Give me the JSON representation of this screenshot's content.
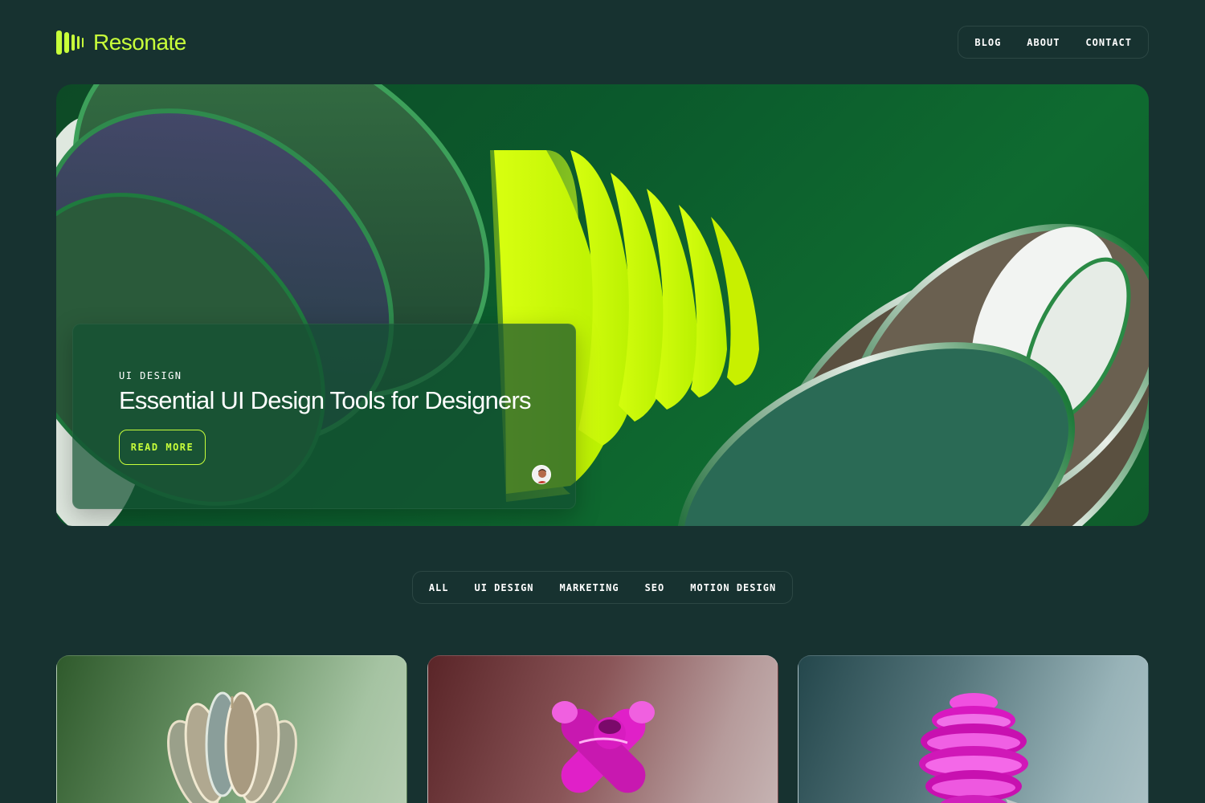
{
  "brand": {
    "name": "Resonate",
    "accent": "#c8ff3a"
  },
  "nav": {
    "items": [
      "BLOG",
      "ABOUT",
      "CONTACT"
    ]
  },
  "hero": {
    "category": "UI DESIGN",
    "title": "Essential UI Design Tools for Designers",
    "cta": "READ MORE"
  },
  "filters": [
    "ALL",
    "UI DESIGN",
    "MARKETING",
    "SEO",
    "MOTION DESIGN"
  ],
  "cards": [
    {
      "icon": "chrome-flower-sculpture"
    },
    {
      "icon": "magenta-cross-sculpture"
    },
    {
      "icon": "magenta-spiral-sculpture"
    }
  ],
  "colors": {
    "background": "#173230",
    "accent": "#c8ff3a",
    "magenta": "#e020c8"
  }
}
